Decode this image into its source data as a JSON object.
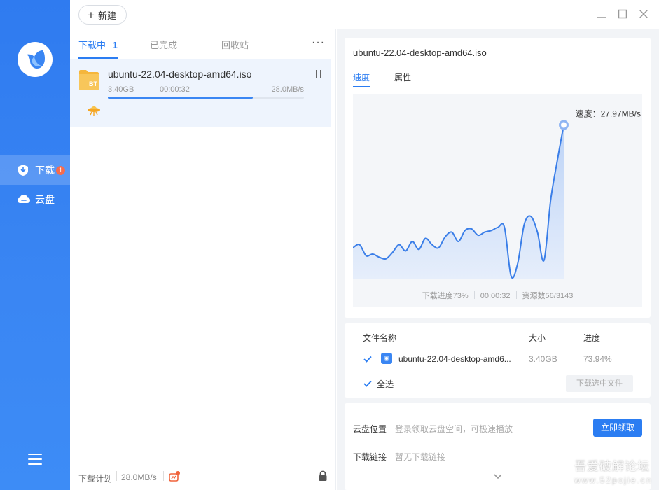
{
  "sidebar": {
    "items": [
      {
        "label": "下载",
        "badge": "1",
        "icon": "download-shield-icon",
        "active": true
      },
      {
        "label": "云盘",
        "icon": "cloud-icon",
        "active": false
      }
    ],
    "menu_icon": "hamburger-menu-icon"
  },
  "topbar": {
    "new_label": "新建"
  },
  "list": {
    "tabs": [
      {
        "label": "下载中",
        "count": "1",
        "active": true
      },
      {
        "label": "已完成",
        "active": false
      },
      {
        "label": "回收站",
        "active": false
      }
    ],
    "more": "···",
    "task": {
      "name": "ubuntu-22.04-desktop-amd64.iso",
      "folder_badge": "BT",
      "size": "3.40GB",
      "elapsed": "00:00:32",
      "speed": "28.0MB/s",
      "progress": 0.74
    },
    "footer": {
      "plan_label": "下载计划",
      "speed": "28.0MB/s"
    }
  },
  "detail": {
    "title": "ubuntu-22.04-desktop-amd64.iso",
    "tabs": [
      "速度",
      "属性"
    ],
    "chart_data": {
      "type": "area",
      "series": [
        {
          "values": [
            20,
            22,
            15,
            16,
            14,
            13,
            17,
            22,
            18,
            24,
            19,
            26,
            22,
            20,
            27,
            30,
            24,
            31,
            32,
            28,
            30,
            31,
            33,
            33,
            2,
            10,
            35,
            40,
            30,
            12,
            50,
            75,
            98
          ]
        }
      ],
      "annotation": "速度：27.97MB/s",
      "colors": {
        "line": "#3a7ee8",
        "fill_top": "#bcd3f7",
        "fill_bottom": "#e6eefb"
      }
    },
    "stats": {
      "progress": "下载进度73%",
      "elapsed": "00:00:32",
      "resources": "资源数56/3143"
    },
    "files": {
      "headers": {
        "name": "文件名称",
        "size": "大小",
        "progress": "进度"
      },
      "rows": [
        {
          "name": "ubuntu-22.04-desktop-amd6...",
          "size": "3.40GB",
          "progress": "73.94%",
          "checked": true
        }
      ],
      "select_all": "全选",
      "download_selected": "下载选中文件"
    },
    "cloud": {
      "location_label": "云盘位置",
      "location_desc": "登录领取云盘空间，可极速播放",
      "claim_button": "立即领取",
      "link_label": "下载链接",
      "link_desc": "暂无下载链接"
    }
  },
  "watermark": {
    "line1": "吾爱破解论坛",
    "line2": "www.52pojie.cn"
  }
}
